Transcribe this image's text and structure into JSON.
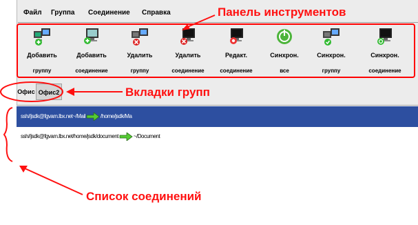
{
  "menu": [
    "Файл",
    "Группа",
    "Соединение",
    "Справка"
  ],
  "toolbar": [
    {
      "line1": "Добавить",
      "line2": "группу",
      "icon": "add-group-icon"
    },
    {
      "line1": "Добавить",
      "line2": "соединение",
      "icon": "add-connection-icon"
    },
    {
      "line1": "Удалить",
      "line2": "группу",
      "icon": "delete-group-icon"
    },
    {
      "line1": "Удалить",
      "line2": "соединение",
      "icon": "delete-connection-icon"
    },
    {
      "line1": "Редакт.",
      "line2": "соединение",
      "icon": "edit-connection-icon"
    },
    {
      "line1": "Синхрон.",
      "line2": "все",
      "icon": "sync-all-icon"
    },
    {
      "line1": "Синхрон.",
      "line2": "группу",
      "icon": "sync-group-icon"
    },
    {
      "line1": "Синхрон.",
      "line2": "соединение",
      "icon": "sync-connection-icon"
    }
  ],
  "tabs": [
    "Офис",
    "Офис2"
  ],
  "connections": [
    {
      "source": "ssh//jsdk@fgvam.lbx.net~/Mail",
      "target": "/home/jsdk/Ma",
      "selected": true
    },
    {
      "source": "ssh//jsdk@fgvam.lbx.net/home/jsdk/document",
      "target": "~/Document",
      "selected": false
    }
  ],
  "annotations": {
    "toolbar": "Панель инструментов",
    "tabs": "Вкладки групп",
    "list": "Список соединений"
  },
  "colors": {
    "accent": "#ff0000",
    "selection": "#2d4fa0"
  }
}
